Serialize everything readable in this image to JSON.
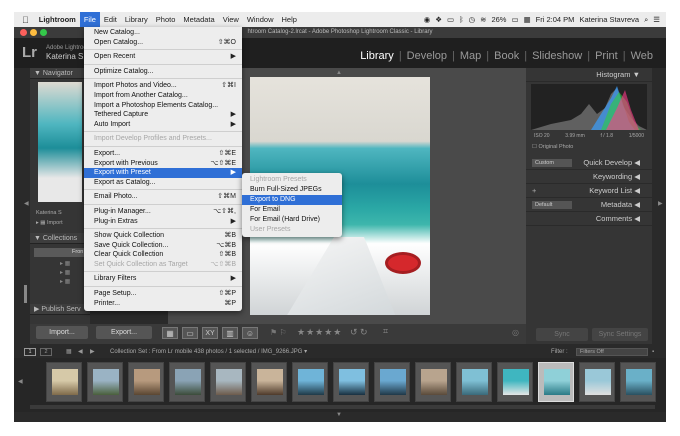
{
  "menubar": {
    "apple": "",
    "items": [
      "Lightroom",
      "File",
      "Edit",
      "Library",
      "Photo",
      "Metadata",
      "View",
      "Window",
      "Help"
    ],
    "battery": "26%",
    "clock": "Fri 2:04 PM",
    "user": "Katerina Stavreva"
  },
  "window": {
    "title": "htroom Catalog-2.lrcat - Adobe Photoshop Lightroom Classic - Library"
  },
  "identity": {
    "logo": "Lr",
    "product": "Adobe Lightroom",
    "user": "Katerina S"
  },
  "modules": [
    "Library",
    "Develop",
    "Map",
    "Book",
    "Slideshow",
    "Print",
    "Web"
  ],
  "left_panel": {
    "navigator": "Navigator",
    "catalog_user": "Katerina S",
    "catalog_item": "Import",
    "collections": "Collections",
    "collection_from": "Fron",
    "publish": "Publish Serv",
    "import_btn": "Import...",
    "export_btn": "Export..."
  },
  "right_panel": {
    "histogram": "Histogram",
    "iso": "ISO 20",
    "focal": "3.99 mm",
    "aperture": "f / 1.8",
    "shutter": "1/5000",
    "original_photo": "Original Photo",
    "custom": "Custom",
    "quick_develop": "Quick Develop",
    "keywording": "Keywording",
    "keyword_list": "Keyword List",
    "default": "Default",
    "metadata": "Metadata",
    "comments": "Comments",
    "sync": "Sync",
    "sync_settings": "Sync Settings"
  },
  "file_menu": [
    {
      "label": "New Catalog...",
      "shortcut": ""
    },
    {
      "label": "Open Catalog...",
      "shortcut": "⇧⌘O"
    },
    {
      "sep": true
    },
    {
      "label": "Open Recent",
      "shortcut": "▶"
    },
    {
      "sep": true
    },
    {
      "label": "Optimize Catalog...",
      "shortcut": ""
    },
    {
      "sep": true
    },
    {
      "label": "Import Photos and Video...",
      "shortcut": "⇧⌘I"
    },
    {
      "label": "Import from Another Catalog...",
      "shortcut": ""
    },
    {
      "label": "Import a Photoshop Elements Catalog...",
      "shortcut": ""
    },
    {
      "label": "Tethered Capture",
      "shortcut": "▶"
    },
    {
      "label": "Auto Import",
      "shortcut": "▶"
    },
    {
      "sep": true
    },
    {
      "label": "Import Develop Profiles and Presets...",
      "shortcut": "",
      "disabled": true
    },
    {
      "sep": true
    },
    {
      "label": "Export...",
      "shortcut": "⇧⌘E"
    },
    {
      "label": "Export with Previous",
      "shortcut": "⌥⇧⌘E"
    },
    {
      "label": "Export with Preset",
      "shortcut": "▶",
      "highlight": true
    },
    {
      "label": "Export as Catalog...",
      "shortcut": ""
    },
    {
      "sep": true
    },
    {
      "label": "Email Photo...",
      "shortcut": "⇧⌘M"
    },
    {
      "sep": true
    },
    {
      "label": "Plug-in Manager...",
      "shortcut": "⌥⇧⌘,"
    },
    {
      "label": "Plug-in Extras",
      "shortcut": "▶"
    },
    {
      "sep": true
    },
    {
      "label": "Show Quick Collection",
      "shortcut": "⌘B"
    },
    {
      "label": "Save Quick Collection...",
      "shortcut": "⌥⌘B"
    },
    {
      "label": "Clear Quick Collection",
      "shortcut": "⇧⌘B"
    },
    {
      "label": "Set Quick Collection as Target",
      "shortcut": "⌥⇧⌘B",
      "disabled": true
    },
    {
      "sep": true
    },
    {
      "label": "Library Filters",
      "shortcut": "▶"
    },
    {
      "sep": true
    },
    {
      "label": "Page Setup...",
      "shortcut": "⇧⌘P"
    },
    {
      "label": "Printer...",
      "shortcut": "⌘P"
    }
  ],
  "submenu": [
    {
      "label": "Lightroom Presets",
      "disabled": true
    },
    {
      "label": "Burn Full-Sized JPEGs"
    },
    {
      "label": "Export to DNG",
      "highlight": true
    },
    {
      "label": "For Email"
    },
    {
      "label": "For Email (Hard Drive)"
    },
    {
      "label": "User Presets",
      "disabled": true
    }
  ],
  "filmstrip": {
    "page1": "1",
    "page2": "2",
    "info": "Collection Set : From Lr mobile     438 photos / 1 selected / IMG_9266.JPG ▾",
    "filter_label": "Filter :",
    "filter_value": "Filters Off"
  },
  "colors": {
    "highlight": "#2f6fd6",
    "menu_bg": "#ededed",
    "panel_bg": "#353535"
  }
}
